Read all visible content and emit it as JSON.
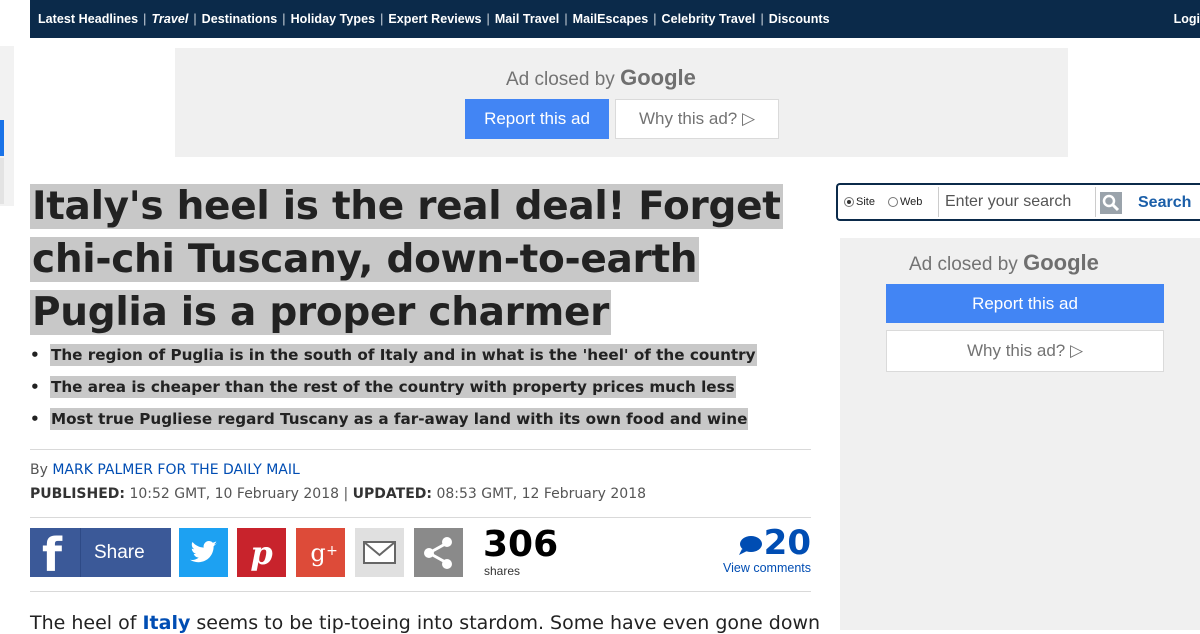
{
  "nav": {
    "items": [
      {
        "label": "Latest Headlines",
        "active": false
      },
      {
        "label": "Travel",
        "active": true
      },
      {
        "label": "Destinations",
        "active": false
      },
      {
        "label": "Holiday Types",
        "active": false
      },
      {
        "label": "Expert Reviews",
        "active": false
      },
      {
        "label": "Mail Travel",
        "active": false
      },
      {
        "label": "MailEscapes",
        "active": false
      },
      {
        "label": "Celebrity Travel",
        "active": false
      },
      {
        "label": "Discounts",
        "active": false
      }
    ],
    "login_label": "Logi"
  },
  "ad_top": {
    "closed_text": "Ad closed by",
    "brand": "Google",
    "report_label": "Report this ad",
    "why_label": "Why this ad? ▷"
  },
  "article": {
    "headline": "Italy's heel is the real deal! Forget chi-chi Tuscany, down-to-earth Puglia is a proper charmer",
    "bullets": [
      "The region of Puglia is in the south of Italy and in what is the 'heel' of the country",
      "The area is cheaper than the rest of the country with property prices much less",
      "Most true Pugliese regard Tuscany as a far-away land with its own food and wine"
    ],
    "by_prefix": "By",
    "author": "MARK PALMER FOR THE DAILY MAIL",
    "published_label": "PUBLISHED:",
    "published_value": "10:52 GMT, 10 February 2018",
    "pub_sep": "|",
    "updated_label": "UPDATED:",
    "updated_value": "08:53 GMT, 12 February 2018",
    "body_start": "The heel of",
    "body_link": "Italy",
    "body_rest": "seems to be tip-toeing into stardom. Some have even gone down"
  },
  "share": {
    "facebook_label": "Share",
    "share_count": "306",
    "share_count_label": "shares",
    "comment_count": "20",
    "comment_label": "View comments",
    "icons": [
      "facebook-icon",
      "twitter-icon",
      "pinterest-icon",
      "google-plus-icon",
      "email-icon",
      "share-icon"
    ],
    "colors": {
      "facebook": "#3b5998",
      "twitter": "#1da1f2",
      "pinterest": "#c8232c",
      "google_plus": "#dd4b39",
      "email": "#e0e0e0",
      "share": "#8a8a8a"
    }
  },
  "search": {
    "radio_site": "Site",
    "radio_web": "Web",
    "placeholder": "Enter your search",
    "button_label": "Search"
  },
  "ad_right": {
    "closed_text": "Ad closed by",
    "brand": "Google",
    "report_label": "Report this ad",
    "why_label": "Why this ad? ▷"
  },
  "colors": {
    "nav_bg": "#0b2a4a",
    "link": "#004db3",
    "ad_blue": "#4285f4"
  }
}
